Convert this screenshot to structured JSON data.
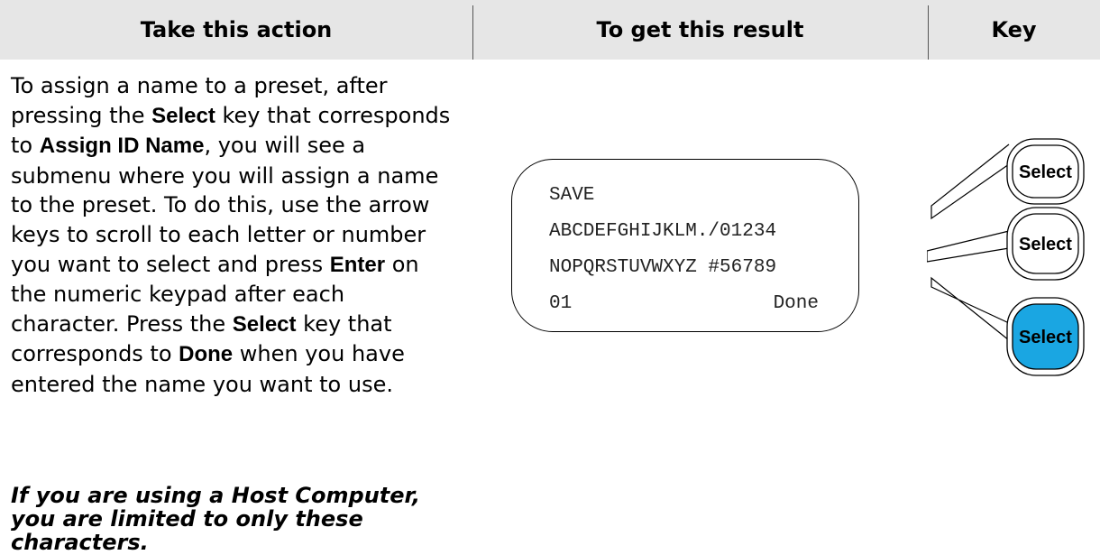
{
  "header": {
    "col_action": "Take this action",
    "col_result": "To get this result",
    "col_key": "Key"
  },
  "instructions": {
    "t1": "To assign a name to a preset, after pressing the ",
    "b1": "Select",
    "t2": " key that corresponds to ",
    "b2": "Assign ID Name",
    "t3": ", you will see a submenu where you will assign a name to the preset. To do this, use the arrow keys to scroll to each letter or number you want to select and press ",
    "b3": "Enter",
    "t4": " on the numeric keypad after each character. Press the ",
    "b4": "Select",
    "t5": " key that corresponds to ",
    "b5": "Done",
    "t6": " when you have entered the name you want to use."
  },
  "note": "If you are using a Host Computer, you are limited to only these characters.",
  "display": {
    "line1": "SAVE",
    "line2": "ABCDEFGHIJKLM./01234",
    "line3": "NOPQRSTUVWXYZ #56789",
    "line4_left": "01",
    "line4_right": "Done"
  },
  "keys": [
    {
      "label": "Select",
      "active": false
    },
    {
      "label": "Select",
      "active": false
    },
    {
      "label": "Select",
      "active": true
    }
  ],
  "colors": {
    "header_bg": "#e6e6e6",
    "active_key": "#1aa6e2"
  }
}
